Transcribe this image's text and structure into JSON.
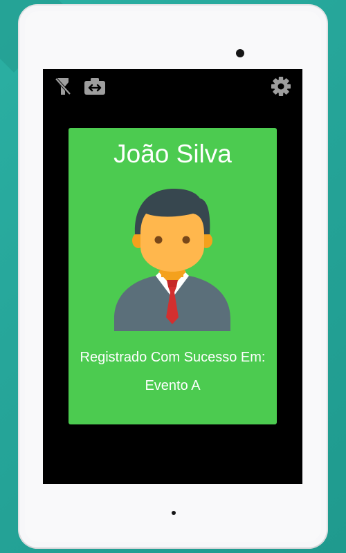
{
  "colors": {
    "background": "#26A69A",
    "device_frame": "#F7F7F9",
    "screen": "#000000",
    "card_success": "#4CCB50",
    "text": "#FFFFFF",
    "icon": "#9E9E9E"
  },
  "toolbar": {
    "flash_icon": "flash-off",
    "switch_camera_icon": "switch-camera",
    "settings_icon": "gear"
  },
  "registration_card": {
    "person_name": "João Silva",
    "avatar_icon": "businessman-avatar",
    "status_message": "Registrado Com Sucesso Em:",
    "event_name": "Evento A"
  }
}
